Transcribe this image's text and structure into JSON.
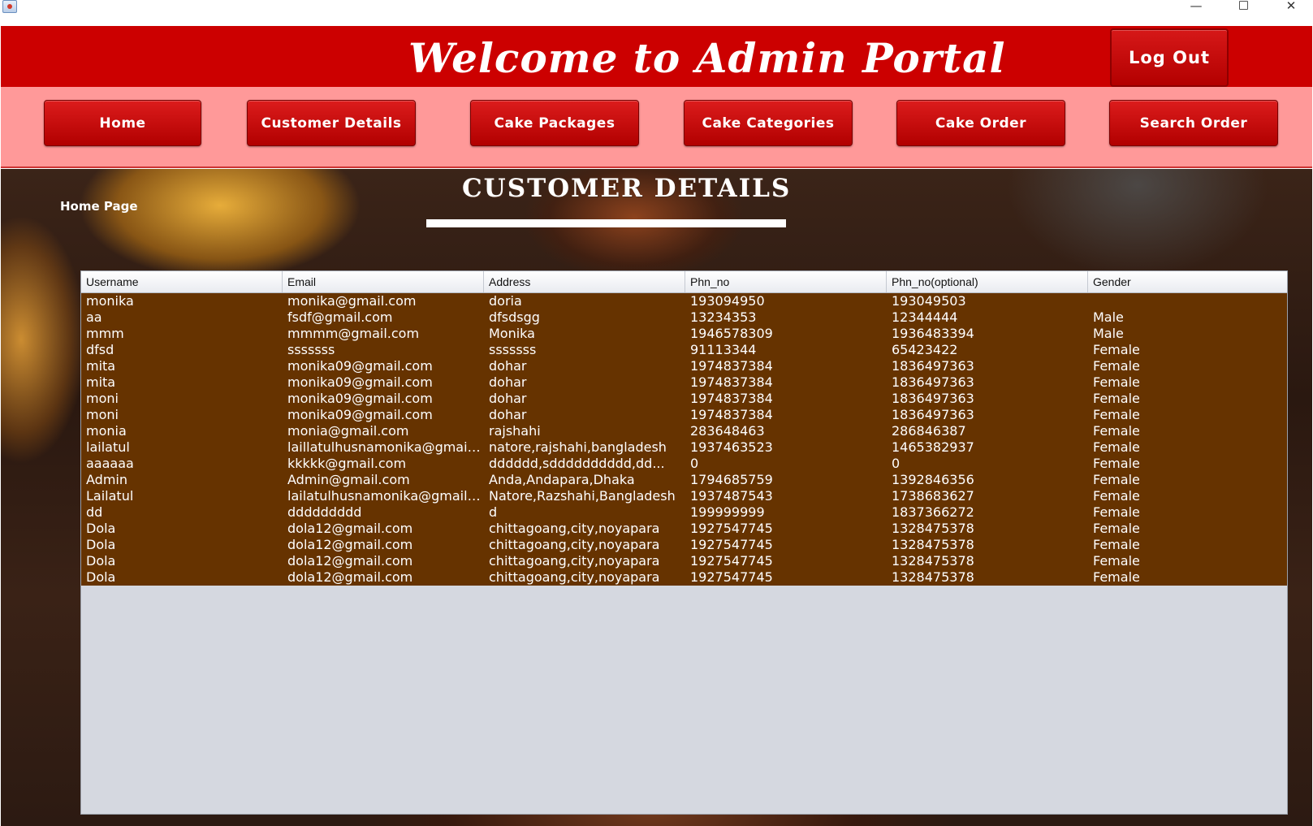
{
  "window": {
    "icon": "java-app-icon",
    "controls": {
      "minimize": "—",
      "close": "✕"
    }
  },
  "header": {
    "welcome": "Welcome to  Admin Portal",
    "logout_label": "Log Out",
    "accent_color": "#cc0000"
  },
  "nav": {
    "home": "Home",
    "customer_details": "Customer Details",
    "cake_packages": "Cake Packages",
    "cake_categories": "Cake Categories",
    "cake_order": "Cake Order",
    "search_order": "Search Order",
    "bar_color": "#ff9999"
  },
  "page": {
    "title": "CUSTOMER DETAILS",
    "home_link": "Home Page"
  },
  "table": {
    "columns": [
      "Username",
      "Email",
      "Address",
      "Phn_no",
      "Phn_no(optional)",
      "Gender"
    ],
    "row_color": "#663300",
    "rows": [
      [
        "monika",
        "monika@gmail.com",
        "doria",
        "193094950",
        "193049503",
        ""
      ],
      [
        "aa",
        "fsdf@gmail.com",
        "dfsdsgg",
        "13234353",
        "12344444",
        "Male"
      ],
      [
        "mmm",
        "mmmm@gmail.com",
        "Monika",
        "1946578309",
        "1936483394",
        "Male"
      ],
      [
        "dfsd",
        "sssssss",
        "sssssss",
        "91113344",
        "65423422",
        "Female"
      ],
      [
        "mita",
        "monika09@gmail.com",
        "dohar",
        "1974837384",
        "1836497363",
        "Female"
      ],
      [
        "mita",
        "monika09@gmail.com",
        "dohar",
        "1974837384",
        "1836497363",
        "Female"
      ],
      [
        "moni",
        "monika09@gmail.com",
        "dohar",
        "1974837384",
        "1836497363",
        "Female"
      ],
      [
        "moni",
        "monika09@gmail.com",
        "dohar",
        "1974837384",
        "1836497363",
        "Female"
      ],
      [
        "monia",
        "monia@gmail.com",
        "rajshahi",
        "283648463",
        "286846387",
        "Female"
      ],
      [
        "lailatul",
        "laillatulhusnamonika@gmail....",
        "natore,rajshahi,bangladesh",
        "1937463523",
        "1465382937",
        "Female"
      ],
      [
        "aaaaaa",
        "kkkkk@gmail.com",
        "dddddd,sdddddddddd,dd...",
        "0",
        "0",
        "Female"
      ],
      [
        "Admin",
        "Admin@gmail.com",
        "Anda,Andapara,Dhaka",
        "1794685759",
        "1392846356",
        "Female"
      ],
      [
        "Lailatul",
        "lailatulhusnamonika@gmail....",
        "Natore,Razshahi,Bangladesh",
        "1937487543",
        "1738683627",
        "Female"
      ],
      [
        "dd",
        "ddddddddd",
        "d",
        "199999999",
        "1837366272",
        "Female"
      ],
      [
        "Dola",
        "dola12@gmail.com",
        "chittagoang,city,noyapara",
        "1927547745",
        "1328475378",
        "Female"
      ],
      [
        "Dola",
        "dola12@gmail.com",
        "chittagoang,city,noyapara",
        "1927547745",
        "1328475378",
        "Female"
      ],
      [
        "Dola",
        "dola12@gmail.com",
        "chittagoang,city,noyapara",
        "1927547745",
        "1328475378",
        "Female"
      ],
      [
        "Dola",
        "dola12@gmail.com",
        "chittagoang,city,noyapara",
        "1927547745",
        "1328475378",
        "Female"
      ]
    ]
  }
}
